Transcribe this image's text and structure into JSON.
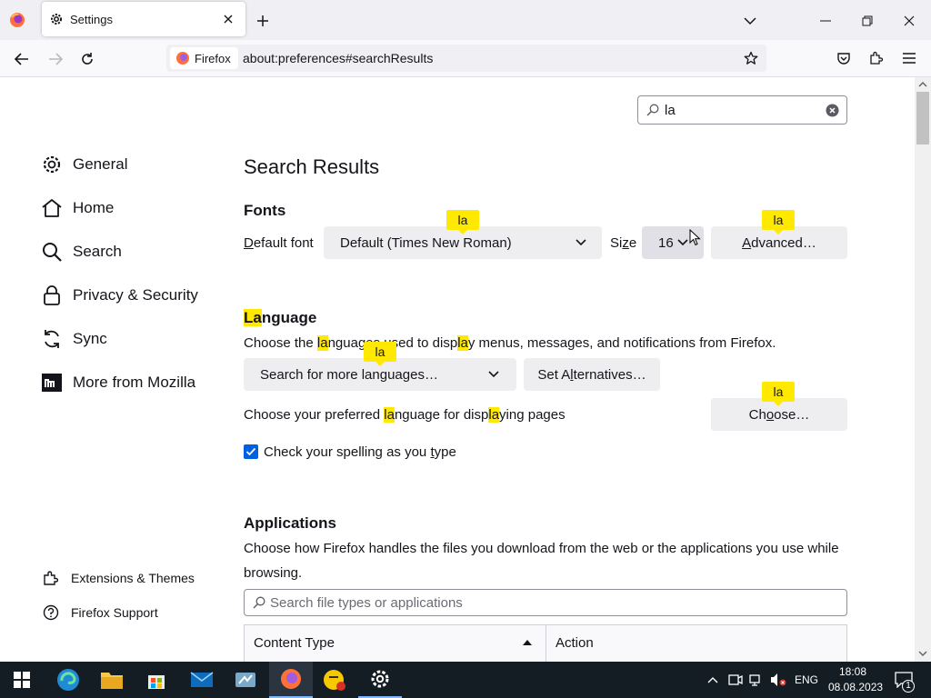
{
  "tabbar": {
    "tab_title": "Settings"
  },
  "navbar": {
    "identity_label": "Firefox",
    "url": "about:preferences#searchResults"
  },
  "search": {
    "value": "la"
  },
  "sidebar": {
    "items": [
      {
        "label": "General",
        "icon": "gear-icon"
      },
      {
        "label": "Home",
        "icon": "home-icon"
      },
      {
        "label": "Search",
        "icon": "search-icon"
      },
      {
        "label": "Privacy & Security",
        "icon": "lock-icon"
      },
      {
        "label": "Sync",
        "icon": "sync-icon"
      },
      {
        "label": "More from Mozilla",
        "icon": "mozilla-icon"
      }
    ],
    "footer": [
      {
        "label": "Extensions & Themes",
        "icon": "puzzle-icon"
      },
      {
        "label": "Firefox Support",
        "icon": "help-icon"
      }
    ]
  },
  "main": {
    "title": "Search Results",
    "fonts": {
      "heading": "Fonts",
      "default_font_label_pre": "",
      "default_font_label_u": "D",
      "default_font_label_post": "efault font",
      "default_font_value": "Default (Times New Roman)",
      "size_label_u": "z",
      "size_label_pre": "Si",
      "size_label_post": "e",
      "size_value": "16",
      "advanced_pre": "",
      "advanced_u": "A",
      "advanced_post": "dvanced…"
    },
    "language": {
      "heading_hl": "La",
      "heading_rest": "nguage",
      "desc_1": "Choose the ",
      "desc_hl1": "la",
      "desc_2": "nguages used to disp",
      "desc_hl2": "la",
      "desc_3": "y menus, messages, and notifications from Firefox.",
      "more_languages": "Search for more languages…",
      "set_alt_pre": "Set A",
      "set_alt_u": "l",
      "set_alt_post": "ternatives…",
      "pref_1": "Choose your preferred ",
      "pref_hl1": "la",
      "pref_2": "nguage for disp",
      "pref_hl2": "la",
      "pref_3": "ying pages",
      "choose_pre": "Ch",
      "choose_u": "o",
      "choose_post": "ose…",
      "spell_pre": "Check your spelling as you ",
      "spell_u": "t",
      "spell_post": "ype"
    },
    "tips": [
      "la",
      "la",
      "la",
      "la"
    ],
    "applications": {
      "heading": "Applications",
      "desc_line1": "Choose how Firefox handles the files you download from the web or the applications you use while",
      "desc_line2": "browsing.",
      "search_placeholder": "Search file types or applications",
      "col_content_type": "Content Type",
      "col_action": "Action"
    }
  },
  "taskbar": {
    "lang": "ENG",
    "time": "18:08",
    "date": "08.08.2023",
    "notification_count": "1"
  },
  "colors": {
    "accent": "#0061e0",
    "highlight": "#ffe900",
    "taskbar": "#141c24"
  }
}
